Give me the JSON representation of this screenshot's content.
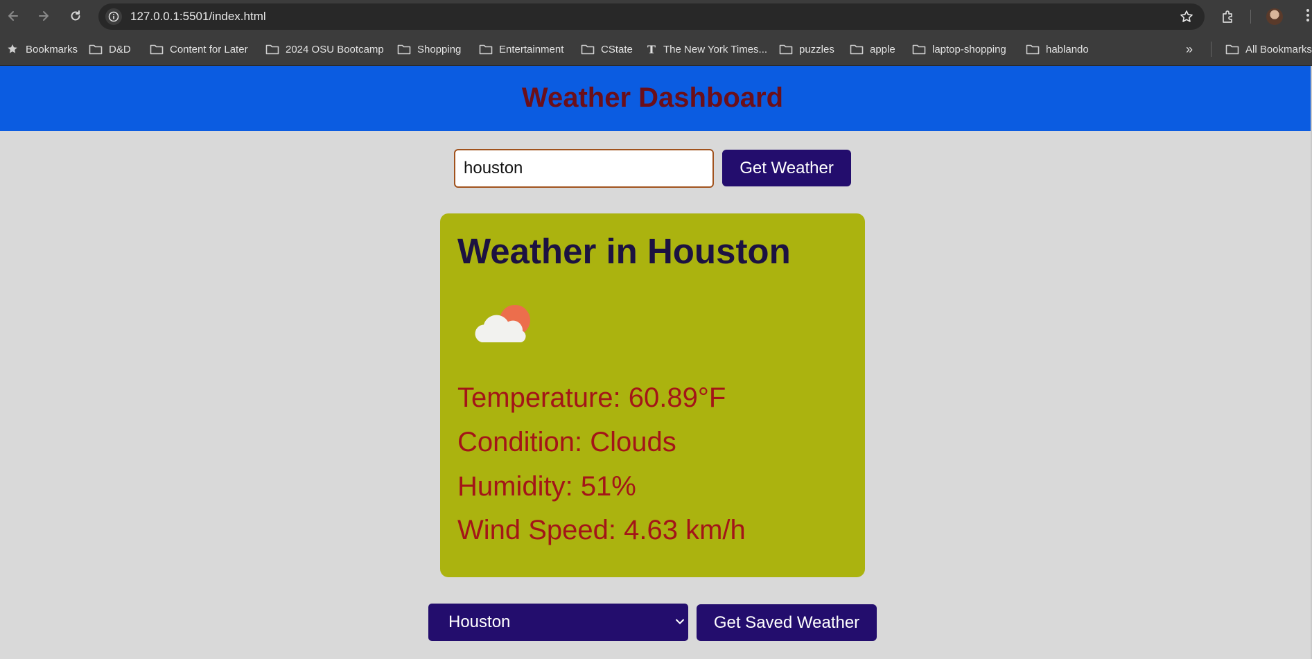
{
  "browser": {
    "url": "127.0.0.1:5501/index.html",
    "bookmarks": [
      {
        "label": "Bookmarks",
        "icon": "star-icon"
      },
      {
        "label": "D&D",
        "icon": "folder-icon"
      },
      {
        "label": "Content for Later",
        "icon": "folder-icon"
      },
      {
        "label": "2024 OSU Bootcamp",
        "icon": "folder-icon"
      },
      {
        "label": "Shopping",
        "icon": "folder-icon"
      },
      {
        "label": "Entertainment",
        "icon": "folder-icon"
      },
      {
        "label": "CState",
        "icon": "folder-icon"
      },
      {
        "label": "The New York Times...",
        "icon": "nyt-icon"
      },
      {
        "label": "puzzles",
        "icon": "folder-icon"
      },
      {
        "label": "apple",
        "icon": "folder-icon"
      },
      {
        "label": "laptop-shopping",
        "icon": "folder-icon"
      },
      {
        "label": "hablando",
        "icon": "folder-icon"
      }
    ],
    "all_bookmarks_label": "All Bookmarks",
    "overflow_label": "»"
  },
  "header": {
    "title": "Weather Dashboard"
  },
  "search": {
    "value": "houston",
    "button_label": "Get Weather"
  },
  "weather": {
    "title": "Weather in Houston",
    "icon": "partly-cloudy-icon",
    "temperature": "Temperature: 60.89°F",
    "condition": "Condition: Clouds",
    "humidity": "Humidity: 51%",
    "wind_speed": "Wind Speed: 4.63 km/h"
  },
  "saved": {
    "selected": "Houston",
    "button_label": "Get Saved Weather"
  },
  "colors": {
    "header_bg": "#0b5ce1",
    "title_text": "#6b0f1a",
    "card_bg": "#abb30f",
    "card_title": "#1c1241",
    "stat_text": "#a31518",
    "button_bg": "#230d6d",
    "page_bg": "#d9d9d9"
  }
}
